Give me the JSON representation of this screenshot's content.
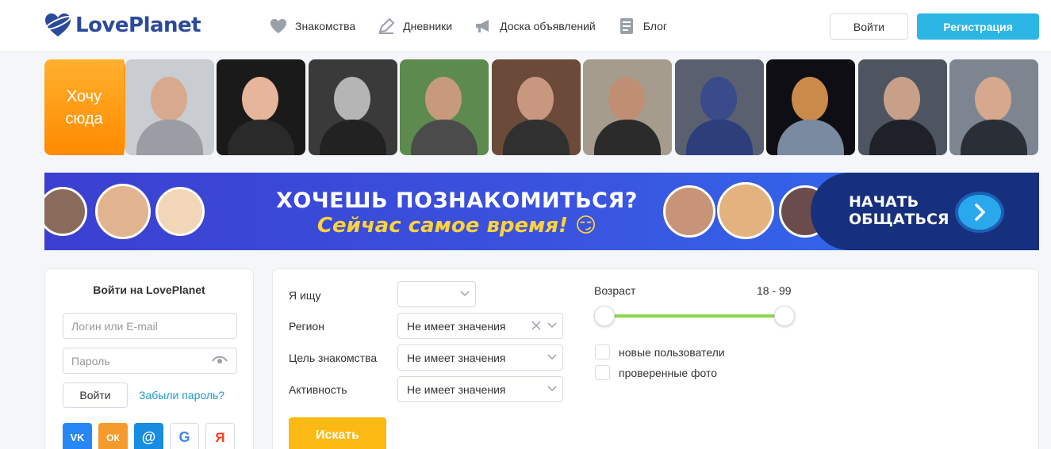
{
  "header": {
    "logo_text": "LovePlanet",
    "nav": [
      {
        "label": "Знакомства",
        "icon": "heart-icon"
      },
      {
        "label": "Дневники",
        "icon": "pencil-icon"
      },
      {
        "label": "Доска объявлений",
        "icon": "megaphone-icon"
      },
      {
        "label": "Блог",
        "icon": "document-icon"
      }
    ],
    "login_label": "Войти",
    "register_label": "Регистрация"
  },
  "strip": {
    "want_here_line1": "Хочу",
    "want_here_line2": "сюда",
    "photos_count_note": "10 user photos"
  },
  "banner": {
    "title": "ХОЧЕШЬ ПОЗНАКОМИТЬСЯ?",
    "subtitle": "Сейчас самое время! 😏",
    "cta_line1": "НАЧАТЬ",
    "cta_line2": "ОБЩАТЬСЯ"
  },
  "login": {
    "title": "Войти на LovePlanet",
    "login_placeholder": "Логин или E-mail",
    "password_placeholder": "Пароль",
    "login_button": "Войти",
    "forgot_link": "Забыли пароль?",
    "socials": [
      {
        "name": "vk",
        "glyph": "VK"
      },
      {
        "name": "ok",
        "glyph": "ОК"
      },
      {
        "name": "mail",
        "glyph": "@"
      },
      {
        "name": "google",
        "glyph": "G"
      },
      {
        "name": "yandex",
        "glyph": "Я"
      }
    ]
  },
  "search": {
    "looking_for_label": "Я ищу",
    "looking_for_value": "",
    "region_label": "Регион",
    "region_value": "Не имеет значения",
    "goal_label": "Цель знакомства",
    "goal_value": "Не имеет значения",
    "activity_label": "Активность",
    "activity_value": "Не имеет значения",
    "age_label": "Возраст",
    "age_value": "18 - 99",
    "age_min": 18,
    "age_max": 99,
    "new_users_label": "новые пользователи",
    "verified_photos_label": "проверенные фото",
    "search_button": "Искать"
  },
  "colors": {
    "brand_blue": "#2b4a9b",
    "accent_cyan": "#2cb6e3",
    "orange": "#ff9a10",
    "yellow_button": "#fdb913",
    "slider_green": "#8dd64a"
  }
}
